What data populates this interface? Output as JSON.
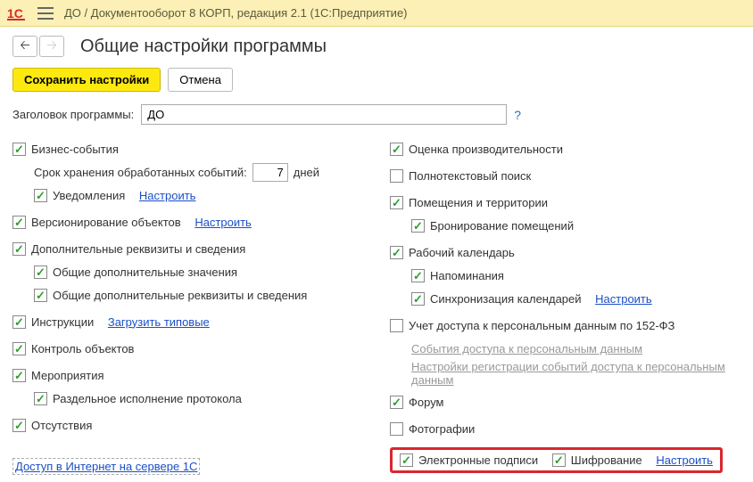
{
  "titlebar": {
    "text": "ДО / Документооборот 8 КОРП, редакция 2.1  (1С:Предприятие)"
  },
  "page": {
    "heading": "Общие настройки программы"
  },
  "buttons": {
    "save": "Сохранить настройки",
    "cancel": "Отмена"
  },
  "header": {
    "label": "Заголовок программы:",
    "value": "ДО",
    "help": "?"
  },
  "left": {
    "business_events": "Бизнес-события",
    "retention_label": "Срок хранения обработанных событий:",
    "retention_value": "7",
    "retention_unit": "дней",
    "notifications": "Уведомления",
    "notifications_link": "Настроить",
    "versioning": "Версионирование объектов",
    "versioning_link": "Настроить",
    "extra_props": "Дополнительные реквизиты и сведения",
    "extra_values": "Общие дополнительные значения",
    "extra_common": "Общие дополнительные реквизиты и сведения",
    "instructions": "Инструкции",
    "instructions_link": "Загрузить типовые",
    "control": "Контроль объектов",
    "events": "Мероприятия",
    "events_split": "Раздельное исполнение протокола",
    "absences": "Отсутствия"
  },
  "right": {
    "performance": "Оценка производительности",
    "fulltext": "Полнотекстовый поиск",
    "premises": "Помещения и территории",
    "booking": "Бронирование помещений",
    "calendar": "Рабочий календарь",
    "reminders": "Напоминания",
    "sync": "Синхронизация календарей",
    "sync_link": "Настроить",
    "personal_data": "Учет доступа к персональным данным по 152-ФЗ",
    "pd_link1": "События доступа к персональным данным",
    "pd_link2": "Настройки регистрации событий доступа к персональным данным",
    "forum": "Форум",
    "photos": "Фотографии",
    "esign": "Электронные подписи",
    "encryption": "Шифрование",
    "esign_link": "Настроить"
  },
  "footer": {
    "link": "Доступ в Интернет на сервере 1С"
  }
}
